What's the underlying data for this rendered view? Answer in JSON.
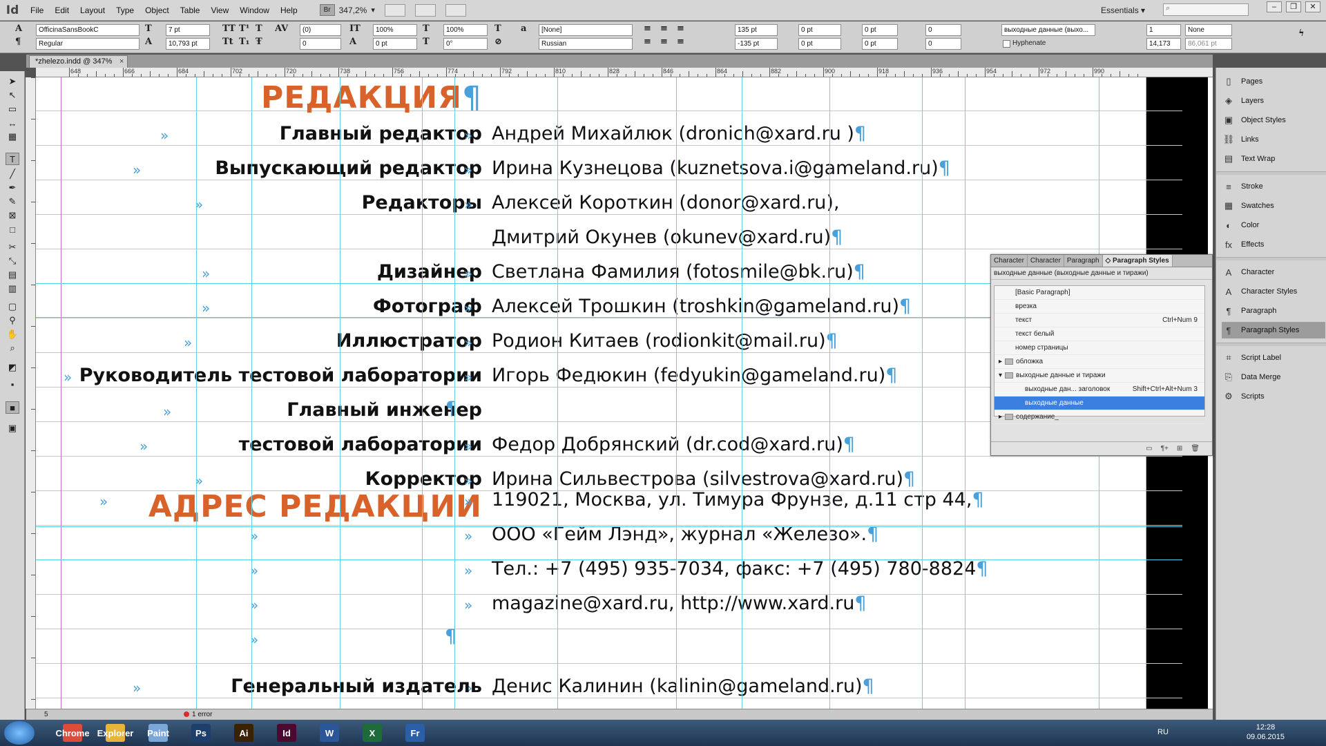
{
  "app": {
    "logo": "Id",
    "menu": [
      "File",
      "Edit",
      "Layout",
      "Type",
      "Object",
      "Table",
      "View",
      "Window",
      "Help"
    ],
    "bridge_badge": "Br",
    "zoom": "347,2%",
    "workspace": "Essentials",
    "search_placeholder": ""
  },
  "control_panel": {
    "font_family": "OfficinaSansBookC",
    "font_style": "Regular",
    "font_size": "7 pt",
    "leading": "10,793 pt",
    "kerning": "(0)",
    "tracking": "0",
    "vertical_scale": "100%",
    "horizontal_scale": "100%",
    "baseline_shift": "0 pt",
    "skew": "0°",
    "char_style": "[None]",
    "language": "Russian",
    "left_indent": "135 pt",
    "first_line_indent": "-135 pt",
    "right_indent": "0 pt",
    "last_line_indent": "0 pt",
    "space_before": "0 pt",
    "space_after": "0 pt",
    "drop_cap_lines": "0",
    "drop_cap_chars": "0",
    "para_style": "выходные данные (выхо...",
    "hyphenate_label": "Hyphenate",
    "bullets": "None",
    "columns": "1",
    "column_width": "14,173",
    "gutter": "86,061 pt"
  },
  "document": {
    "tab_title": "*zhelezo.indd @ 347%",
    "tab_close": "×",
    "ruler_marks": [
      "648",
      "666",
      "684",
      "702",
      "720",
      "738",
      "756",
      "774",
      "792",
      "810",
      "828",
      "846",
      "864",
      "882",
      "900",
      "918",
      "936",
      "954",
      "972",
      "990"
    ]
  },
  "content": {
    "heading1": "РЕДАКЦИЯ",
    "heading2": "АДРЕС РЕДАКЦИИ",
    "pilcrow": "¶",
    "tab_marker": "»",
    "rows": [
      {
        "label": "Главный редактор",
        "value": "Андрей Михайлюк (dronich@xard.ru )"
      },
      {
        "label": "Выпускающий редактор",
        "value": "Ирина Кузнецова (kuznetsova.i@gameland.ru)"
      },
      {
        "label": "Редакторы",
        "value": "Алексей Короткин (donor@xard.ru),"
      },
      {
        "label": "",
        "value": "Дмитрий Окунев (okunev@xard.ru)"
      },
      {
        "label": "Дизайнер",
        "value": "Светлана Фамилия (fotosmile@bk.ru)"
      },
      {
        "label": "Фотограф",
        "value": "Алексей Трошкин (troshkin@gameland.ru)"
      },
      {
        "label": "Иллюстратор",
        "value": "Родион Китаев (rodionkit@mail.ru)"
      },
      {
        "label": "Руководитель тестовой лаборатории",
        "value": "Игорь Федюкин (fedyukin@gameland.ru)"
      },
      {
        "label": "Главный инженер",
        "value": ""
      },
      {
        "label": "тестовой лаборатории",
        "value": "Федор Добрянский (dr.cod@xard.ru)"
      },
      {
        "label": "Корректор",
        "value": "Ирина Сильвестрова (silvestrova@xard.ru)"
      }
    ],
    "address": [
      "119021, Москва, ул. Тимура Фрунзе, д.11 стр 44,",
      "ООО «Гейм Лэнд», журнал «Железо».",
      "Тел.: +7 (495) 935-7034, факс: +7 (495) 780-8824",
      "magazine@xard.ru, http://www.xard.ru"
    ],
    "publisher_label": "Генеральный издатель",
    "publisher_value": "Денис Калинин (kalinin@gameland.ru)"
  },
  "dock": {
    "group1": [
      "Pages",
      "Layers",
      "Object Styles",
      "Links",
      "Text Wrap"
    ],
    "group2": [
      "Stroke",
      "Swatches",
      "Color",
      "Effects"
    ],
    "group3": [
      "Character",
      "Character Styles",
      "Paragraph",
      "Paragraph Styles"
    ],
    "group4": [
      "Script Label",
      "Data Merge",
      "Scripts"
    ]
  },
  "paragraph_panel": {
    "tabs": [
      "Character",
      "Character",
      "Paragraph",
      "◇ Paragraph Styles"
    ],
    "current": "выходные данные (выходные данные и тиражи)",
    "styles": [
      {
        "name": "[Basic Paragraph]",
        "shortcut": "",
        "kind": "style"
      },
      {
        "name": "врезка",
        "shortcut": "",
        "kind": "style"
      },
      {
        "name": "текст",
        "shortcut": "Ctrl+Num 9",
        "kind": "style"
      },
      {
        "name": "текст белый",
        "shortcut": "",
        "kind": "style"
      },
      {
        "name": "номер страницы",
        "shortcut": "",
        "kind": "style"
      },
      {
        "name": "обложка",
        "shortcut": "",
        "kind": "folder"
      },
      {
        "name": "выходные данные и тиражи",
        "shortcut": "",
        "kind": "folder-open"
      },
      {
        "name": "выходные дан... заголовок",
        "shortcut": "Shift+Ctrl+Alt+Num 3",
        "kind": "child"
      },
      {
        "name": "выходные данные",
        "shortcut": "",
        "kind": "child-selected"
      },
      {
        "name": "содержание_",
        "shortcut": "",
        "kind": "folder"
      }
    ]
  },
  "status": {
    "page": "5",
    "errors": "1 error"
  },
  "taskbar": {
    "lang": "RU",
    "time": "12:28",
    "date": "09.06.2015",
    "apps": [
      "Chrome",
      "Explorer",
      "Paint",
      "Ps",
      "Ai",
      "Id",
      "W",
      "X",
      "Fr"
    ]
  },
  "colors": {
    "heading": "#d9622b",
    "guide": "#4fd3e2",
    "selection": "#3b7fe0"
  }
}
